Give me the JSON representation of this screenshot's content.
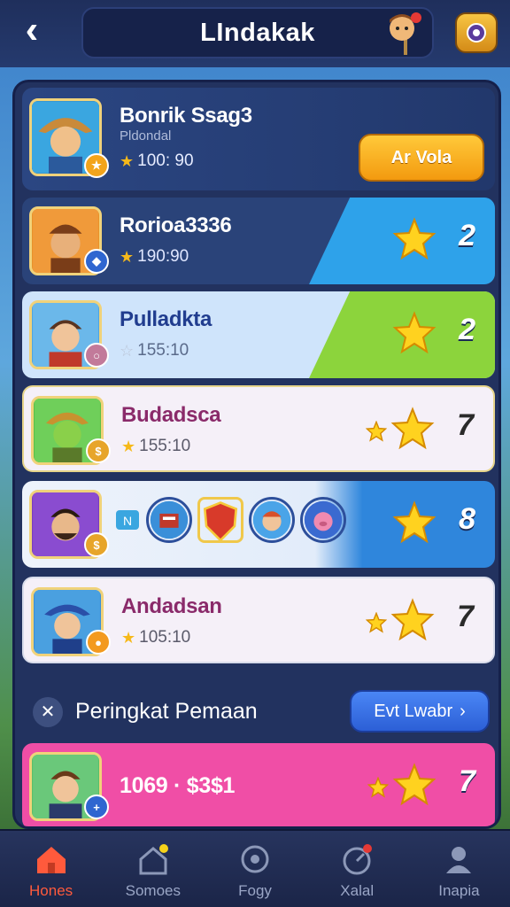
{
  "header": {
    "title": "LIndakak"
  },
  "colors": {
    "accent_blue": "#2ea2ea",
    "accent_green": "#8cd43c",
    "accent_pink": "#f04ea6",
    "button_yellow": "#f6a91a",
    "star": "#f6b91a"
  },
  "top_entry": {
    "name": "Bonrik Ssag3",
    "subtitle": "Pldondal",
    "score": "100: 90",
    "button": "Ar Vola"
  },
  "rows": [
    {
      "name": "Rorioa3336",
      "score": "190:90",
      "rank": "2"
    },
    {
      "name": "Pulladkta",
      "score": "155:10",
      "rank": "2"
    },
    {
      "name": "Budadsca",
      "score": "155:10",
      "rank": "7"
    },
    {
      "rank": "8"
    },
    {
      "name": "Andadsan",
      "score": "105:10",
      "rank": "7"
    }
  ],
  "section": {
    "title": "Peringkat Pemaan",
    "button": "Evt Lwabr"
  },
  "bottom_entry": {
    "name": "1069 · $3$1",
    "rank": "7"
  },
  "nav": [
    {
      "label": "Hones",
      "icon": "home-icon",
      "active": true
    },
    {
      "label": "Somoes",
      "icon": "house-badge-icon"
    },
    {
      "label": "Fogy",
      "icon": "compass-icon"
    },
    {
      "label": "Xalal",
      "icon": "gauge-icon"
    },
    {
      "label": "Inapia",
      "icon": "user-icon"
    }
  ]
}
